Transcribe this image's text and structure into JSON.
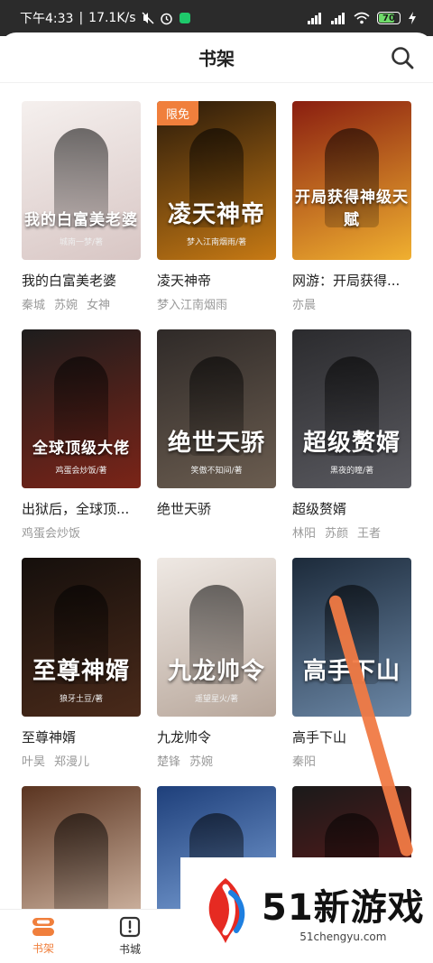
{
  "status_bar": {
    "time": "下午4:33",
    "speed": "17.1K/s",
    "battery": "70"
  },
  "header": {
    "title": "书架"
  },
  "books": [
    {
      "name": "我的白富美老婆",
      "tags": [
        "秦城",
        "苏婉",
        "女神"
      ],
      "cover_title": "我的白富美老婆",
      "cover_author": "城南一梦/著",
      "colors": [
        "#f5f0ee",
        "#d8c6c4"
      ],
      "badge": ""
    },
    {
      "name": "凌天神帝",
      "tags": [
        "梦入江南烟雨"
      ],
      "cover_title": "凌天神帝",
      "cover_author": "梦入江南烟雨/著",
      "colors": [
        "#2a1a0a",
        "#c77a14"
      ],
      "badge": "限免"
    },
    {
      "name": "网游：开局获得...",
      "tags": [
        "亦晨"
      ],
      "cover_title": "开局获得神级天赋",
      "cover_author": "",
      "colors": [
        "#8a1e10",
        "#f0b030"
      ],
      "badge": ""
    },
    {
      "name": "出狱后，全球顶...",
      "tags": [
        "鸡蛋会炒饭"
      ],
      "cover_title": "全球顶级大佬",
      "cover_author": "鸡蛋会炒饭/著",
      "colors": [
        "#1d1d1d",
        "#7b2418"
      ],
      "badge": ""
    },
    {
      "name": "绝世天骄",
      "tags": [],
      "cover_title": "绝世天骄",
      "cover_author": "笑傲不知间/著",
      "colors": [
        "#2f2a28",
        "#6b5d50"
      ],
      "badge": ""
    },
    {
      "name": "超级赘婿",
      "tags": [
        "林阳",
        "苏颜",
        "王者"
      ],
      "cover_title": "超级赘婿",
      "cover_author": "黑夜的瞳/著",
      "colors": [
        "#2b2b2e",
        "#5a5a60"
      ],
      "badge": ""
    },
    {
      "name": "至尊神婿",
      "tags": [
        "叶昊",
        "郑漫儿"
      ],
      "cover_title": "至尊神婿",
      "cover_author": "狼牙土豆/著",
      "colors": [
        "#150f0c",
        "#4a2a1a"
      ],
      "badge": ""
    },
    {
      "name": "九龙帅令",
      "tags": [
        "楚锋",
        "苏婉"
      ],
      "cover_title": "九龙帅令",
      "cover_author": "遥望星火/著",
      "colors": [
        "#efe9e4",
        "#b7a69a"
      ],
      "badge": ""
    },
    {
      "name": "高手下山",
      "tags": [
        "秦阳"
      ],
      "cover_title": "高手下山",
      "cover_author": "",
      "colors": [
        "#1c2a3a",
        "#6b87a6"
      ],
      "badge": ""
    },
    {
      "name": "",
      "tags": [],
      "cover_title": "",
      "cover_author": "",
      "colors": [
        "#5a3420",
        "#e0c7b4"
      ],
      "badge": ""
    },
    {
      "name": "",
      "tags": [],
      "cover_title": "",
      "cover_author": "",
      "colors": [
        "#1e3f7a",
        "#8ab1e6"
      ],
      "badge": ""
    },
    {
      "name": "",
      "tags": [],
      "cover_title": "",
      "cover_author": "",
      "colors": [
        "#1a1a1a",
        "#7a1a1a"
      ],
      "badge": ""
    }
  ],
  "bottom_nav": {
    "shelf_label": "书架",
    "store_label": "书城"
  },
  "watermark": {
    "main": "51新游戏",
    "sub": "51chengyu.com"
  },
  "theme": {
    "accent": "#f07f3c"
  }
}
